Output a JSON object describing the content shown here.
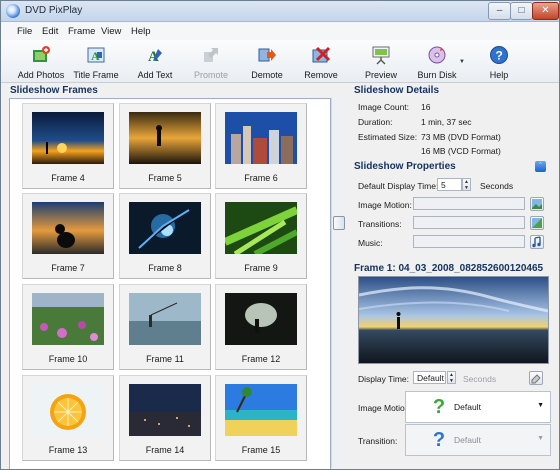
{
  "window": {
    "title": "DVD PixPlay"
  },
  "menu": [
    "File",
    "Edit",
    "Frame",
    "View",
    "Help"
  ],
  "toolbar": {
    "add_photos": "Add Photos",
    "title_frame": "Title Frame",
    "add_text": "Add Text",
    "promote": "Promote",
    "demote": "Demote",
    "remove": "Remove",
    "preview": "Preview",
    "burn_disk": "Burn Disk",
    "help": "Help"
  },
  "frames_panel": {
    "heading": "Slideshow Frames",
    "frames": [
      {
        "label": "Frame 4",
        "icon": "sunset-silhouette-photo"
      },
      {
        "label": "Frame 5",
        "icon": "person-sunset-photo"
      },
      {
        "label": "Frame 6",
        "icon": "las-vegas-photo"
      },
      {
        "label": "Frame 7",
        "icon": "dog-silhouette-photo"
      },
      {
        "label": "Frame 8",
        "icon": "abstract-splash-photo"
      },
      {
        "label": "Frame 9",
        "icon": "green-leaves-photo"
      },
      {
        "label": "Frame 10",
        "icon": "flowers-field-photo"
      },
      {
        "label": "Frame 11",
        "icon": "fisherman-lake-photo"
      },
      {
        "label": "Frame 12",
        "icon": "cave-light-photo"
      },
      {
        "label": "Frame 13",
        "icon": "orange-slice-photo"
      },
      {
        "label": "Frame 14",
        "icon": "city-night-photo"
      },
      {
        "label": "Frame 15",
        "icon": "beach-photo"
      }
    ]
  },
  "details": {
    "heading": "Slideshow Details",
    "image_count_label": "Image Count:",
    "image_count": "16",
    "duration_label": "Duration:",
    "duration": "1 min, 37 sec",
    "size_label": "Estimated Size:",
    "size_dvd": "73 MB (DVD Format)",
    "size_vcd": "16 MB (VCD Format)"
  },
  "properties": {
    "heading": "Slideshow Properties",
    "default_time_label": "Default Display Time:",
    "default_time": "5",
    "seconds": "Seconds",
    "image_motion_label": "Image Motion:",
    "transitions_label": "Transitions:",
    "music_label": "Music:"
  },
  "frame": {
    "heading": "Frame 1: 04_03_2008_082852600120465",
    "display_time_label": "Display Time:",
    "display_time": "Default",
    "seconds": "Seconds",
    "image_motion_label": "Image Motion:",
    "image_motion_value": "Default",
    "transition_label": "Transition:",
    "transition_value": "Default"
  }
}
